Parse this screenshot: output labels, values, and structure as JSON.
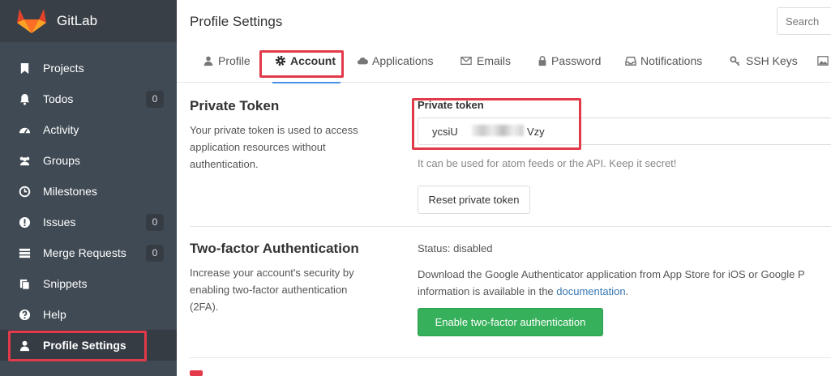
{
  "brand": {
    "name": "GitLab",
    "logo_icon": "gitlab-fox-logo-icon"
  },
  "sidebar": {
    "items": [
      {
        "label": "Projects",
        "icon": "bookmark-icon",
        "badge": ""
      },
      {
        "label": "Todos",
        "icon": "bell-icon",
        "badge": "0"
      },
      {
        "label": "Activity",
        "icon": "dashboard-icon",
        "badge": ""
      },
      {
        "label": "Groups",
        "icon": "users-icon",
        "badge": ""
      },
      {
        "label": "Milestones",
        "icon": "clock-icon",
        "badge": ""
      },
      {
        "label": "Issues",
        "icon": "exclamation-circle-icon",
        "badge": "0"
      },
      {
        "label": "Merge Requests",
        "icon": "list-icon",
        "badge": "0"
      },
      {
        "label": "Snippets",
        "icon": "clipboard-icon",
        "badge": ""
      },
      {
        "label": "Help",
        "icon": "question-circle-icon",
        "badge": ""
      },
      {
        "label": "Profile Settings",
        "icon": "user-icon",
        "badge": "",
        "active": true
      }
    ]
  },
  "header": {
    "title": "Profile Settings",
    "search_placeholder": "Search"
  },
  "tabs": [
    {
      "label": "Profile",
      "icon": "user-icon"
    },
    {
      "label": "Account",
      "icon": "gear-icon",
      "active": true
    },
    {
      "label": "Applications",
      "icon": "cloud-icon"
    },
    {
      "label": "Emails",
      "icon": "envelope-icon"
    },
    {
      "label": "Password",
      "icon": "lock-icon"
    },
    {
      "label": "Notifications",
      "icon": "inbox-icon"
    },
    {
      "label": "SSH Keys",
      "icon": "key-icon"
    },
    {
      "label": "",
      "icon": "image-icon"
    }
  ],
  "private_token": {
    "title": "Private Token",
    "description": "Your private token is used to access application resources without authentication.",
    "field_label": "Private token",
    "token_prefix": "ycsiU",
    "token_suffix": "Vzy",
    "hint": "It can be used for atom feeds or the API. Keep it secret!",
    "reset_button": "Reset private token"
  },
  "two_factor": {
    "title": "Two-factor Authentication",
    "description": "Increase your account's security by enabling two-factor authentication (2FA).",
    "status": "Status: disabled",
    "text_line1": "Download the Google Authenticator application from App Store for iOS or Google P",
    "text_line2_prefix": "information is available in the ",
    "text_link": "documentation",
    "text_line2_suffix": ".",
    "enable_button": "Enable two-factor authentication"
  },
  "colors": {
    "sidebar_bg": "#404a54",
    "brand_bg": "#383f47",
    "active_tab_underline": "#4a90e2",
    "success": "#36b05a",
    "annotation": "#e23a4a",
    "link": "#3777b0"
  }
}
